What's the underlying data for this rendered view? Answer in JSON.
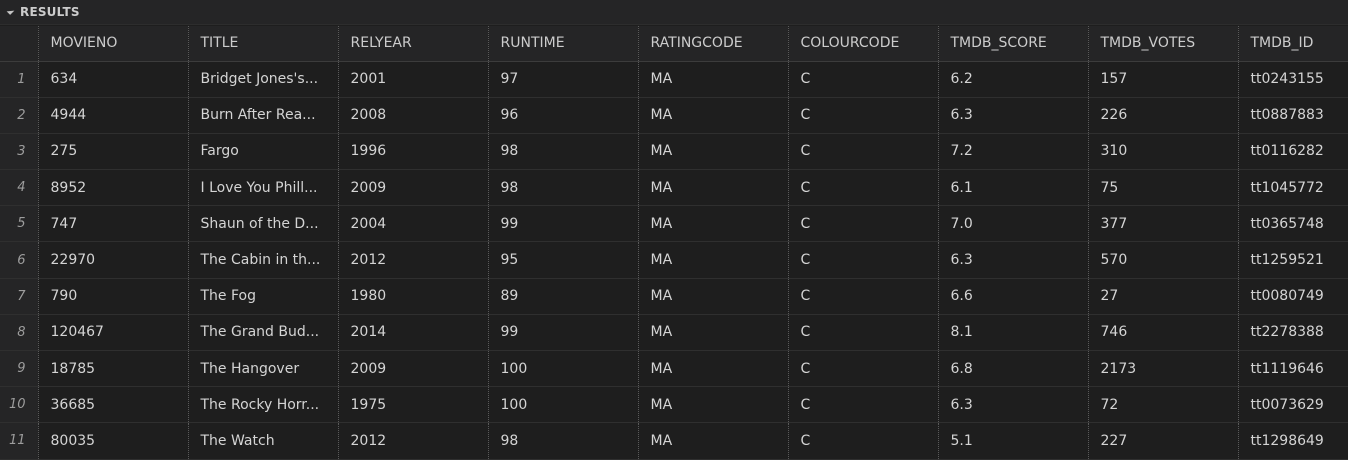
{
  "panel": {
    "title": "RESULTS",
    "toggle_icon": "triangle-collapse-icon"
  },
  "grid": {
    "columns": [
      "MOVIENO",
      "TITLE",
      "RELYEAR",
      "RUNTIME",
      "RATINGCODE",
      "COLOURCODE",
      "TMDB_SCORE",
      "TMDB_VOTES",
      "TMDB_ID"
    ],
    "rows": [
      {
        "n": "1",
        "cells": [
          "634",
          "Bridget Jones's...",
          "2001",
          "97",
          "MA",
          "C",
          "6.2",
          "157",
          "tt0243155"
        ]
      },
      {
        "n": "2",
        "cells": [
          "4944",
          "Burn After Rea...",
          "2008",
          "96",
          "MA",
          "C",
          "6.3",
          "226",
          "tt0887883"
        ]
      },
      {
        "n": "3",
        "cells": [
          "275",
          "Fargo",
          "1996",
          "98",
          "MA",
          "C",
          "7.2",
          "310",
          "tt0116282"
        ]
      },
      {
        "n": "4",
        "cells": [
          "8952",
          "I Love You Phill...",
          "2009",
          "98",
          "MA",
          "C",
          "6.1",
          "75",
          "tt1045772"
        ]
      },
      {
        "n": "5",
        "cells": [
          "747",
          "Shaun of the D...",
          "2004",
          "99",
          "MA",
          "C",
          "7.0",
          "377",
          "tt0365748"
        ]
      },
      {
        "n": "6",
        "cells": [
          "22970",
          "The Cabin in th...",
          "2012",
          "95",
          "MA",
          "C",
          "6.3",
          "570",
          "tt1259521"
        ]
      },
      {
        "n": "7",
        "cells": [
          "790",
          "The Fog",
          "1980",
          "89",
          "MA",
          "C",
          "6.6",
          "27",
          "tt0080749"
        ]
      },
      {
        "n": "8",
        "cells": [
          "120467",
          "The Grand Bud...",
          "2014",
          "99",
          "MA",
          "C",
          "8.1",
          "746",
          "tt2278388"
        ]
      },
      {
        "n": "9",
        "cells": [
          "18785",
          "The Hangover",
          "2009",
          "100",
          "MA",
          "C",
          "6.8",
          "2173",
          "tt1119646"
        ]
      },
      {
        "n": "10",
        "cells": [
          "36685",
          "The Rocky Horr...",
          "1975",
          "100",
          "MA",
          "C",
          "6.3",
          "72",
          "tt0073629"
        ]
      },
      {
        "n": "11",
        "cells": [
          "80035",
          "The Watch",
          "2012",
          "98",
          "MA",
          "C",
          "5.1",
          "227",
          "tt1298649"
        ]
      }
    ]
  }
}
